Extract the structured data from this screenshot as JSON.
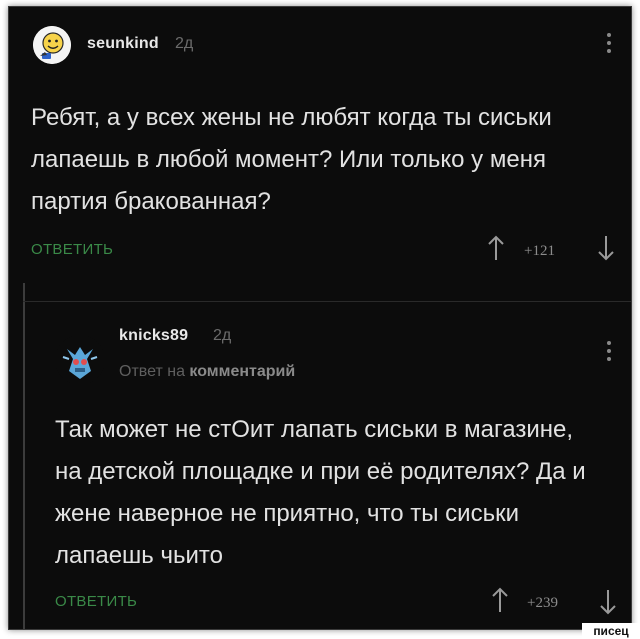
{
  "comment": {
    "username": "seunkind",
    "timestamp": "2д",
    "text": "Ребят, а у всех жены не любят когда ты сиськи лапаешь в любой момент? Или только у меня партия бракованная?",
    "reply_label": "ОТВЕТИТЬ",
    "rating": "+121"
  },
  "reply": {
    "username": "knicks89",
    "timestamp": "2д",
    "meta_prefix": "Ответ на",
    "meta_link": "комментарий",
    "text": "Так может не стОит лапать сиськи в магазине, на детской площадке и при её родителях? Да и жене наверное не приятно, что ты сиськи лапаешь чьито",
    "reply_label": "ОТВЕТИТЬ",
    "rating": "+239"
  },
  "watermark": "писец",
  "colors": {
    "background": "#0c0c0c",
    "text": "#e2e2e2",
    "reply_button": "#3a8a48",
    "muted": "#6b6b6b"
  },
  "icons": {
    "avatar_1": "smiley-avatar",
    "avatar_2": "robot-avatar",
    "menu": "kebab-icon",
    "upvote": "arrow-up-icon",
    "downvote": "arrow-down-icon"
  }
}
